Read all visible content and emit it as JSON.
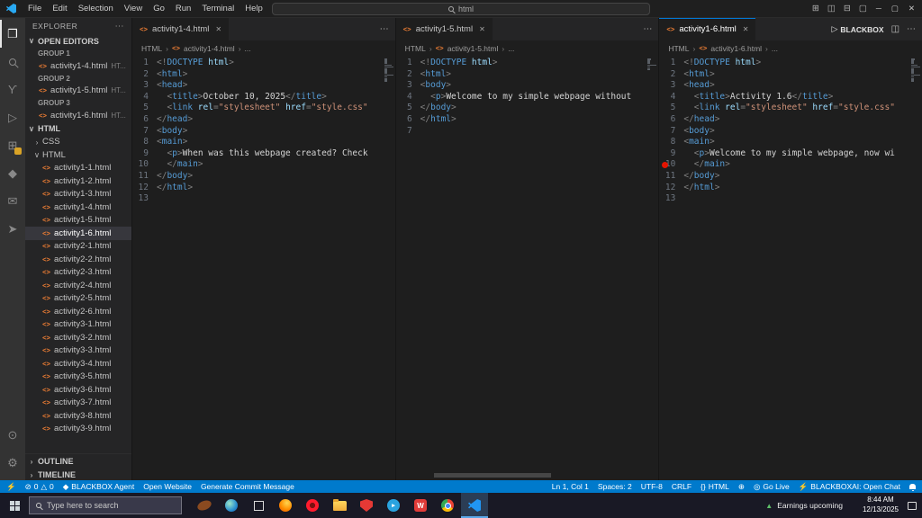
{
  "colors": {
    "status_bar": "#007acc",
    "accent": "#0078d4",
    "html_icon": "#e37933",
    "breakpoint": "#e51400",
    "tag": "#569cd6",
    "attribute": "#9cdcfe",
    "string": "#ce9178"
  },
  "title_bar": {
    "menus": [
      "File",
      "Edit",
      "Selection",
      "View",
      "Go",
      "Run",
      "Terminal",
      "Help"
    ],
    "search_value": "html"
  },
  "activity_bar": {
    "top": [
      {
        "name": "explorer",
        "active": true
      },
      {
        "name": "search"
      },
      {
        "name": "source-control"
      },
      {
        "name": "run-debug"
      },
      {
        "name": "extensions",
        "badge": true
      },
      {
        "name": "blackbox"
      },
      {
        "name": "chat"
      },
      {
        "name": "send"
      }
    ],
    "bottom": [
      {
        "name": "account"
      },
      {
        "name": "settings"
      }
    ]
  },
  "sidebar": {
    "title": "EXPLORER",
    "sections": {
      "open_editors": "OPEN EDITORS",
      "outline": "OUTLINE",
      "timeline": "TIMELINE"
    },
    "open_editor_groups": [
      {
        "label": "GROUP 1",
        "file": "activity1-4.html",
        "desc": "HT..."
      },
      {
        "label": "GROUP 2",
        "file": "activity1-5.html",
        "desc": "HT..."
      },
      {
        "label": "GROUP 3",
        "file": "activity1-6.html",
        "desc": "HT..."
      }
    ],
    "root_folder": "HTML",
    "subfolders": [
      {
        "name": "CSS",
        "expanded": false
      },
      {
        "name": "HTML",
        "expanded": true
      }
    ],
    "files": [
      "activity1-1.html",
      "activity1-2.html",
      "activity1-3.html",
      "activity1-4.html",
      "activity1-5.html",
      "activity1-6.html",
      "activity2-1.html",
      "activity2-2.html",
      "activity2-3.html",
      "activity2-4.html",
      "activity2-5.html",
      "activity2-6.html",
      "activity3-1.html",
      "activity3-2.html",
      "activity3-3.html",
      "activity3-4.html",
      "activity3-5.html",
      "activity3-6.html",
      "activity3-7.html",
      "activity3-8.html",
      "activity3-9.html"
    ],
    "selected_file": "activity1-6.html"
  },
  "editor_actions": {
    "run_label": "BLACKBOX"
  },
  "editor_groups": [
    {
      "tab": "activity1-4.html",
      "breadcrumb_root": "HTML",
      "breadcrumb_more": "...",
      "lines": [
        "<!DOCTYPE html>",
        "<html>",
        "<head>",
        "  <title>October 10, 2025</title>",
        "  <link rel=\"stylesheet\" href=\"style.css\"",
        "</head>",
        "<body>",
        "<main>",
        "  <p>When was this webpage created? Check",
        "  </main>",
        "</body>",
        "</html>",
        ""
      ]
    },
    {
      "tab": "activity1-5.html",
      "breadcrumb_root": "HTML",
      "breadcrumb_more": "...",
      "has_hscroll": true,
      "lines": [
        "<!DOCTYPE html>",
        "<html>",
        "<body>",
        "  <p>Welcome to my simple webpage without",
        "</body>",
        "</html>",
        ""
      ]
    },
    {
      "tab": "activity1-6.html",
      "breadcrumb_root": "HTML",
      "breadcrumb_more": "...",
      "focused": true,
      "show_run": true,
      "breakpoint_line": 10,
      "lines": [
        "<!DOCTYPE html>",
        "<html>",
        "<head>",
        "  <title>Activity 1.6</title>",
        "  <link rel=\"stylesheet\" href=\"style.css\"",
        "</head>",
        "<body>",
        "<main>",
        "  <p>Welcome to my simple webpage, now wi",
        "  </main>",
        "</body>",
        "</html>",
        ""
      ]
    }
  ],
  "status_bar": {
    "problems": {
      "errors": "0",
      "warnings": "0"
    },
    "left": [
      {
        "name": "blackbox-agent",
        "icon": "diamond",
        "label": "BLACKBOX Agent"
      },
      {
        "name": "open-website",
        "label": "Open Website"
      },
      {
        "name": "generate-commit-message",
        "label": "Generate Commit Message"
      }
    ],
    "right": [
      {
        "name": "cursor-position",
        "label": "Ln 1, Col 1"
      },
      {
        "name": "indentation",
        "label": "Spaces: 2"
      },
      {
        "name": "encoding",
        "label": "UTF-8"
      },
      {
        "name": "eol",
        "label": "CRLF"
      },
      {
        "name": "language-mode",
        "icon": "braces",
        "label": "HTML"
      },
      {
        "name": "globe",
        "icon": "globe",
        "label": ""
      },
      {
        "name": "go-live",
        "icon": "broadcast",
        "label": "Go Live"
      },
      {
        "name": "blackboxai-chat",
        "icon": "bolt",
        "label": "BLACKBOXAI: Open Chat"
      }
    ]
  },
  "taskbar": {
    "search_placeholder": "Type here to search",
    "apps": [
      "football",
      "edge",
      "task-view",
      "firefox",
      "opera",
      "file-explorer",
      "security",
      "telegram",
      "wps",
      "chrome",
      "vscode"
    ],
    "active_app": "vscode",
    "widget_label": "Earnings upcoming",
    "time": "8:44 AM",
    "date": "12/13/2025"
  }
}
